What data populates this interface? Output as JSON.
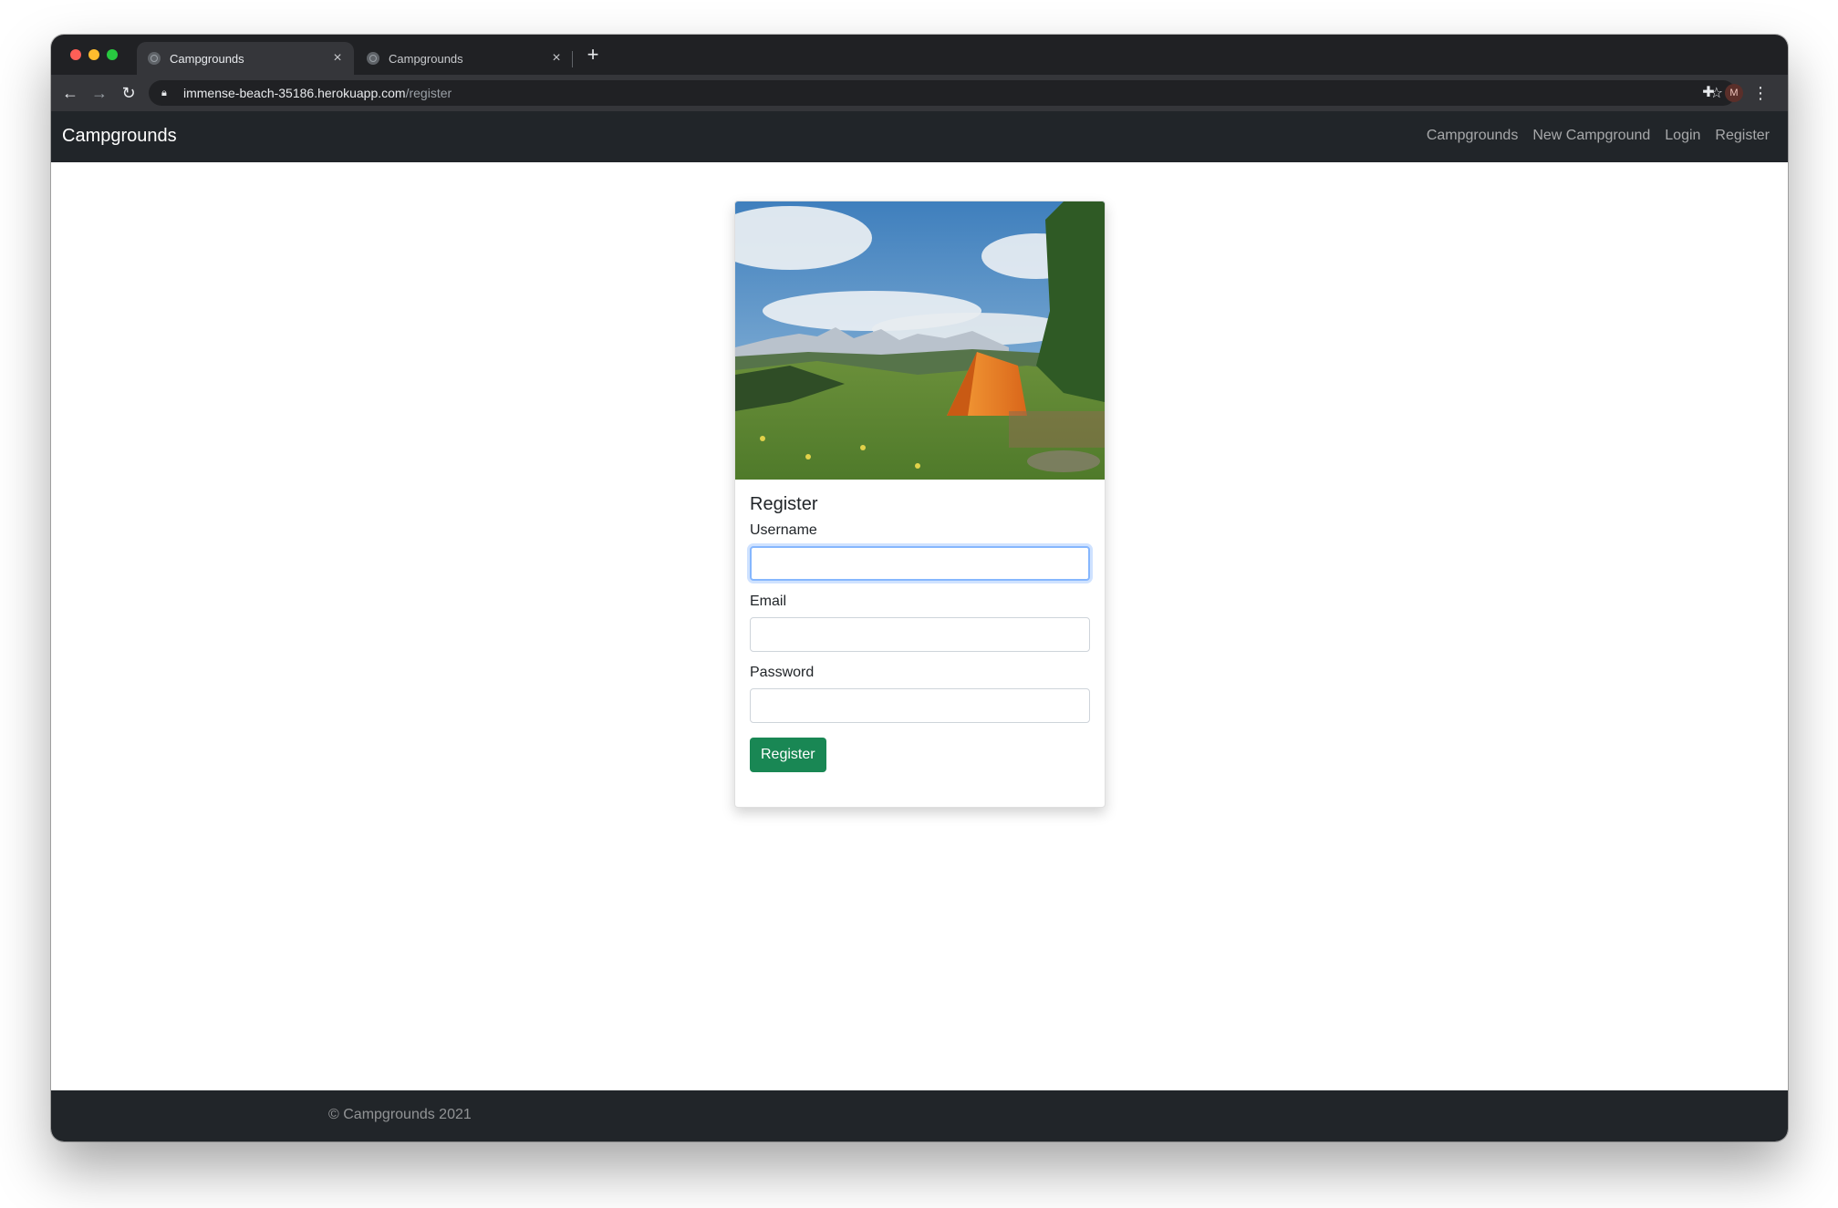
{
  "browser": {
    "tabs": [
      {
        "title": "Campgrounds",
        "active": true
      },
      {
        "title": "Campgrounds",
        "active": false
      }
    ],
    "url_host": "immense-beach-35186.herokuapp.com",
    "url_path": "/register",
    "profile_initial": "M"
  },
  "navbar": {
    "brand": "Campgrounds",
    "links": [
      "Campgrounds",
      "New Campground",
      "Login",
      "Register"
    ]
  },
  "form": {
    "title": "Register",
    "username_label": "Username",
    "email_label": "Email",
    "password_label": "Password",
    "username_value": "",
    "email_value": "",
    "password_value": "",
    "submit_label": "Register"
  },
  "footer": {
    "text": "© Campgrounds 2021"
  },
  "colors": {
    "navbar_bg": "#212529",
    "button_success": "#198754",
    "focus_ring": "#86b7fe"
  }
}
